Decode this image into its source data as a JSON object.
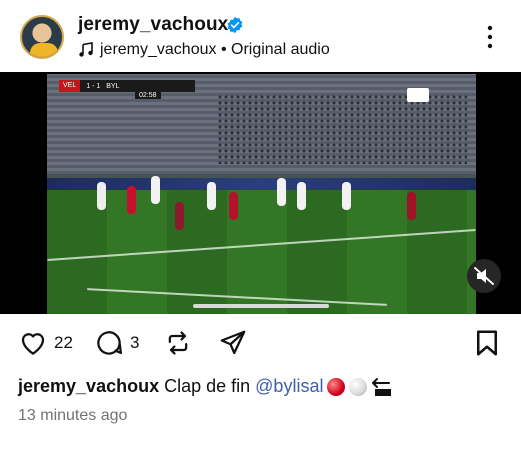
{
  "post": {
    "username": "jeremy_vachoux",
    "audio_label": "jeremy_vachoux • Original audio"
  },
  "video": {
    "score_team1": "VEL",
    "score": "1 - 1",
    "score_team2": "BYL",
    "clock": "02:58",
    "channel": "RTSH",
    "progress_fraction": 0.5
  },
  "actions": {
    "like_count": "22",
    "comment_count": "3"
  },
  "caption": {
    "username": "jeremy_vachoux",
    "text": "Clap de fin",
    "mention": "@bylisal"
  },
  "timestamp": "13 minutes ago",
  "icons": {
    "verified": "verified-badge-icon",
    "audio": "music-note-icon",
    "more": "more-vertical-icon",
    "mute": "muted-speaker-icon",
    "like": "heart-icon",
    "comment": "comment-icon",
    "repost": "repost-icon",
    "share": "send-icon",
    "save": "bookmark-icon"
  },
  "colors": {
    "verified": "#0095f6",
    "mention": "#3f5fa8",
    "muted_text": "#737373"
  }
}
